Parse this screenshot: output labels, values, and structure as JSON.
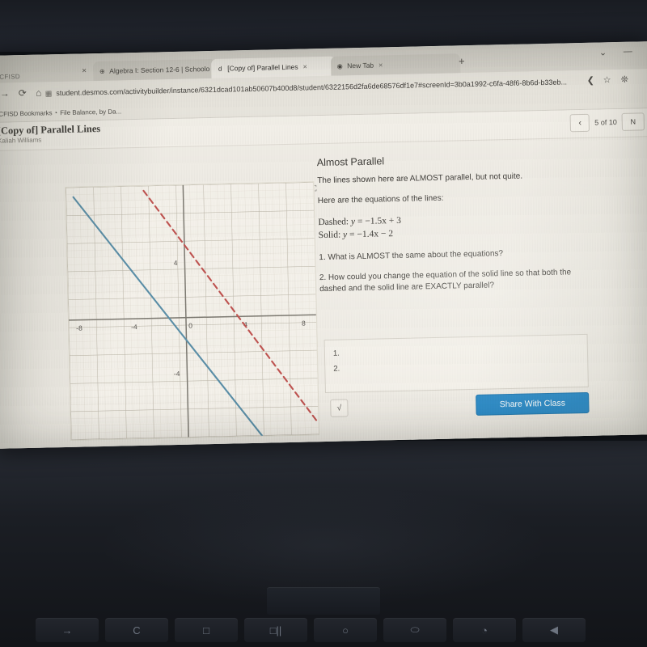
{
  "os": {
    "shelf_keys": [
      "→",
      "C",
      "□",
      "□||",
      "○",
      "⬭",
      "◔",
      "◀"
    ]
  },
  "browser": {
    "profile_label": "CFISD",
    "window_controls": {
      "chevron": "⌄",
      "minimize": "—"
    },
    "new_tab_label": "+",
    "tabs": [
      {
        "title": "Algebra I: Section 12-6 | Schoolo",
        "favicon": "⊕",
        "active": false,
        "close": "×"
      },
      {
        "title": "[Copy of] Parallel Lines",
        "favicon": "d",
        "active": true,
        "close": "×"
      },
      {
        "title": "New Tab",
        "favicon": "◉",
        "active": false,
        "close": "×"
      }
    ],
    "toolbar": {
      "back_icon": "←",
      "forward_icon": "→",
      "reload_icon": "⟳",
      "home_icon": "⌂",
      "page_icon": "Ὓ9",
      "url": "student.desmos.com/activitybuilder/instance/6321dcad101ab50607b400d8/student/6322156d2fa6de68576df1e7#screenId=3b0a1992-c6fa-48f6-8b6d-b33eb...",
      "share_icon": "⟨",
      "bookmark_star_icon": "☆",
      "extensions_icon": "✦"
    },
    "bookmarks": [
      {
        "label": "CFISD Bookmarks",
        "icon": ""
      },
      {
        "label": "File Balance, by Da...",
        "icon": "◔"
      }
    ]
  },
  "activity": {
    "header": {
      "title": "[Copy of] Parallel Lines",
      "student_name": "Kaliah Williams",
      "prev_icon": "‹",
      "page_indicator": "5 of 10",
      "next_label": "N",
      "expand_icon": "⤡"
    },
    "screen": {
      "title": "Almost Parallel",
      "intro": "The lines shown here are ALMOST parallel, but not quite.",
      "equations_lead": "Here are the equations of the lines:",
      "equations": [
        {
          "label": "Dashed:",
          "lhs": "y",
          "rel": "=",
          "rhs": "−1.5x + 3"
        },
        {
          "label": "Solid:",
          "lhs": "y",
          "rel": "=",
          "rhs": "−1.4x − 2"
        }
      ],
      "questions": [
        "1. What is ALMOST the same about the equations?",
        "2. How could you change the equation of the solid line so that both the dashed and the solid line are EXACTLY parallel?"
      ],
      "answer_value_lines": [
        "1.",
        "2."
      ],
      "answer_placeholder": "",
      "math_button_icon": "√",
      "share_button_label": "Share With Class"
    }
  },
  "chart_data": {
    "type": "line",
    "title": "Almost Parallel",
    "xlabel": "",
    "ylabel": "",
    "xlim": [
      -9.2,
      9.2
    ],
    "ylim": [
      -9.2,
      9.2
    ],
    "grid": true,
    "minor_grid": true,
    "legend": "none",
    "x_ticks": [
      -8,
      -4,
      0,
      4,
      8
    ],
    "y_ticks": [
      4,
      -4
    ],
    "x_tick_labels": [
      "-8",
      "-4",
      "0",
      "4",
      "8"
    ],
    "y_tick_labels": [
      "4",
      "-4"
    ],
    "origin_label": "0",
    "series": [
      {
        "name": "Solid",
        "equation": "y = -1.4x - 2",
        "slope": -1.4,
        "intercept": -2,
        "style": "solid",
        "color": "#5b8fa8",
        "points": [
          [
            -8.0,
            9.2
          ],
          [
            8.0,
            -13.2
          ]
        ]
      },
      {
        "name": "Dashed",
        "equation": "y = -1.5x + 3",
        "slope": -1.5,
        "intercept": 3,
        "style": "dashed",
        "color": "#c0504d",
        "points": [
          [
            -4.2,
            9.3
          ],
          [
            9.2,
            -10.8
          ]
        ]
      }
    ]
  }
}
